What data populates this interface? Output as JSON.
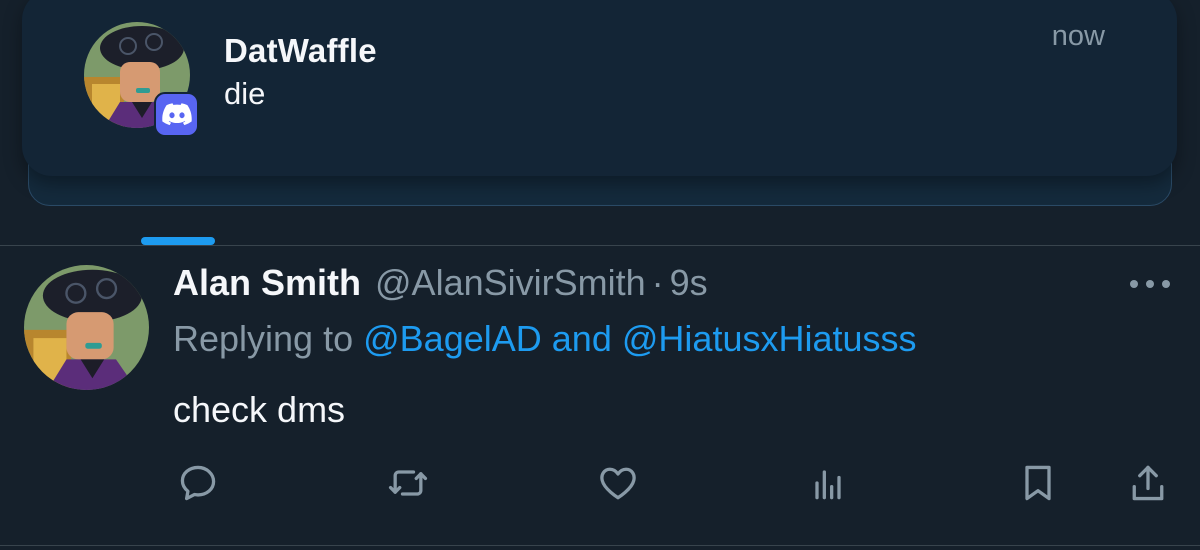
{
  "notification": {
    "sender": "DatWaffle",
    "message": "die",
    "time": "now",
    "app_icon": "discord-icon",
    "app_color": "#5865f2"
  },
  "tweet": {
    "display_name": "Alan Smith",
    "handle": "@AlanSivirSmith",
    "separator": "·",
    "time": "9s",
    "replying_prefix": "Replying to",
    "reply_mention_1": "@BagelAD",
    "reply_and": "and",
    "reply_mention_2": "@HiatusxHiatusss",
    "text": "check dms",
    "actions": [
      "reply-icon",
      "retweet-icon",
      "like-icon",
      "analytics-icon",
      "bookmark-icon",
      "share-icon"
    ]
  },
  "colors": {
    "background": "#15202b",
    "accent": "#1d9bf0",
    "secondary_text": "#8899a6",
    "primary_text": "#f5f7fa"
  }
}
